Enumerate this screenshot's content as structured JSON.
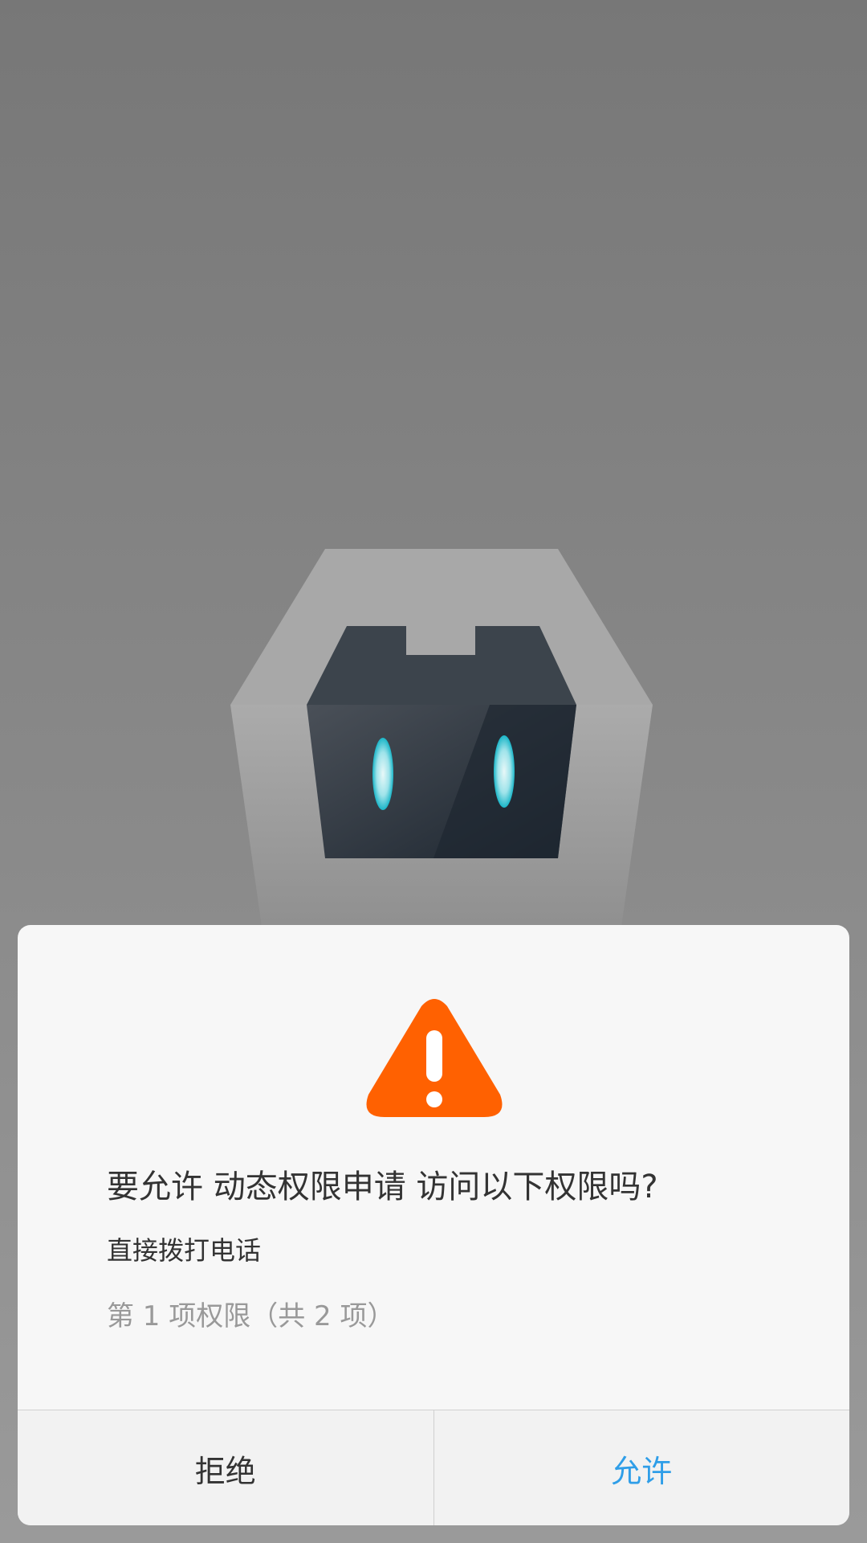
{
  "colors": {
    "accent": "#2f9ee8",
    "warning": "#ff6101",
    "title_text": "#333333",
    "secondary_text": "#999999",
    "dialog_background": "#f7f7f7"
  },
  "splash": {
    "logo_icon": "cordova-robot-icon"
  },
  "dialog": {
    "icon": "warning-triangle-icon",
    "title": "要允许 动态权限申请 访问以下权限吗?",
    "permission": "直接拨打电话",
    "counter": "第 1 项权限（共 2 项）",
    "deny_label": "拒绝",
    "allow_label": "允许"
  }
}
